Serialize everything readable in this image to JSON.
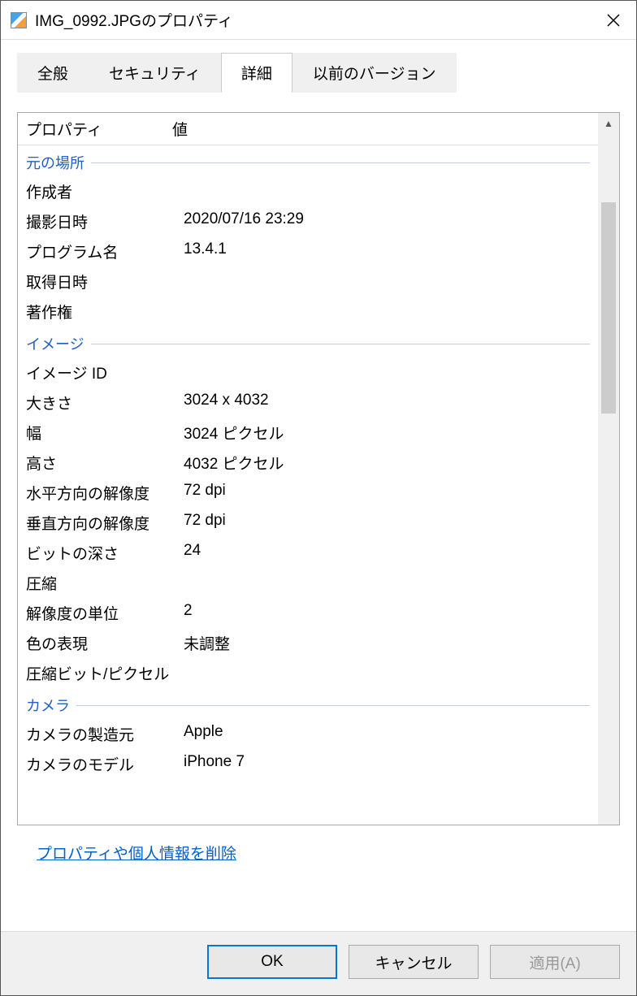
{
  "title": "IMG_0992.JPGのプロパティ",
  "tabs": {
    "general": "全般",
    "security": "セキュリティ",
    "details": "詳細",
    "previous": "以前のバージョン"
  },
  "header": {
    "property": "プロパティ",
    "value": "値"
  },
  "sections": {
    "origin": {
      "title": "元の場所",
      "rows": {
        "author": {
          "label": "作成者",
          "value": ""
        },
        "date_taken": {
          "label": "撮影日時",
          "value": "2020/07/16 23:29"
        },
        "program": {
          "label": "プログラム名",
          "value": "13.4.1"
        },
        "acquired": {
          "label": "取得日時",
          "value": ""
        },
        "copyright": {
          "label": "著作権",
          "value": ""
        }
      }
    },
    "image": {
      "title": "イメージ",
      "rows": {
        "image_id": {
          "label": "イメージ ID",
          "value": ""
        },
        "dimensions": {
          "label": "大きさ",
          "value": "3024 x 4032"
        },
        "width": {
          "label": "幅",
          "value": "3024 ピクセル"
        },
        "height": {
          "label": "高さ",
          "value": "4032 ピクセル"
        },
        "hres": {
          "label": "水平方向の解像度",
          "value": "72 dpi"
        },
        "vres": {
          "label": "垂直方向の解像度",
          "value": "72 dpi"
        },
        "bitdepth": {
          "label": "ビットの深さ",
          "value": "24"
        },
        "compression": {
          "label": "圧縮",
          "value": ""
        },
        "resunit": {
          "label": "解像度の単位",
          "value": "2"
        },
        "colorrep": {
          "label": "色の表現",
          "value": "未調整"
        },
        "compbits": {
          "label": "圧縮ビット/ピクセル",
          "value": ""
        }
      }
    },
    "camera": {
      "title": "カメラ",
      "rows": {
        "maker": {
          "label": "カメラの製造元",
          "value": "Apple"
        },
        "model": {
          "label": "カメラのモデル",
          "value": "iPhone 7"
        }
      }
    }
  },
  "remove_link": "プロパティや個人情報を削除",
  "buttons": {
    "ok": "OK",
    "cancel": "キャンセル",
    "apply": "適用(A)"
  }
}
